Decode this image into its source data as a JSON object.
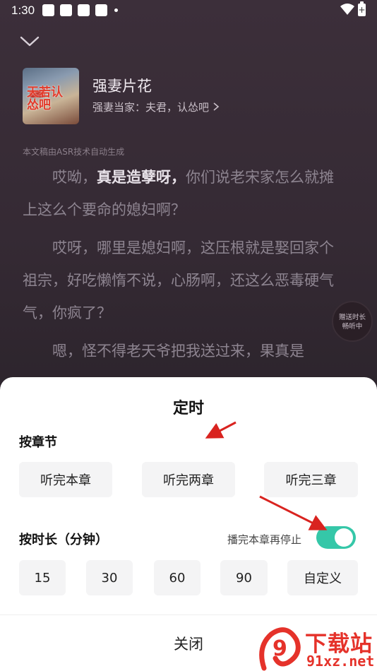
{
  "status_bar": {
    "time": "1:30",
    "battery_glyph": "+"
  },
  "player": {
    "book_title": "强妻片花",
    "book_subtitle": "强妻当家：夫君，认怂吧",
    "cover_text": "天若认怂吧",
    "asr_note": "本文稿由ASR技术自动生成",
    "paragraphs": [
      {
        "pre": "哎呦，",
        "bold": "真是造孽呀，",
        "post": "你们说老宋家怎么就摊上这么个要命的媳妇啊？"
      },
      {
        "pre": "哎呀，哪里是媳妇啊，这压根就是娶回家个祖宗，好吃懒惰不说，心肠啊，还这么恶毒硬气气，你疯了？",
        "bold": "",
        "post": ""
      },
      {
        "pre": "嗯，怪不得老天爷把我送过来，果真是",
        "bold": "",
        "post": ""
      }
    ],
    "badge_lines": [
      "赠送时长",
      "畅听中"
    ]
  },
  "sheet": {
    "title": "定时",
    "by_chapter_label": "按章节",
    "chapter_options": [
      "听完本章",
      "听完两章",
      "听完三章"
    ],
    "by_duration_label": "按时长（分钟）",
    "finish_chapter_label": "播完本章再停止",
    "finish_chapter_enabled": true,
    "minute_options": [
      "15",
      "30",
      "60",
      "90"
    ],
    "custom_label": "自定义",
    "close_label": "关闭"
  },
  "watermark": {
    "cn": "下载站",
    "en": "91xz.net",
    "logo_text": "9"
  },
  "colors": {
    "accent": "#35c7a8",
    "annotation_arrow": "#d9231f",
    "watermark": "#e5322a"
  }
}
